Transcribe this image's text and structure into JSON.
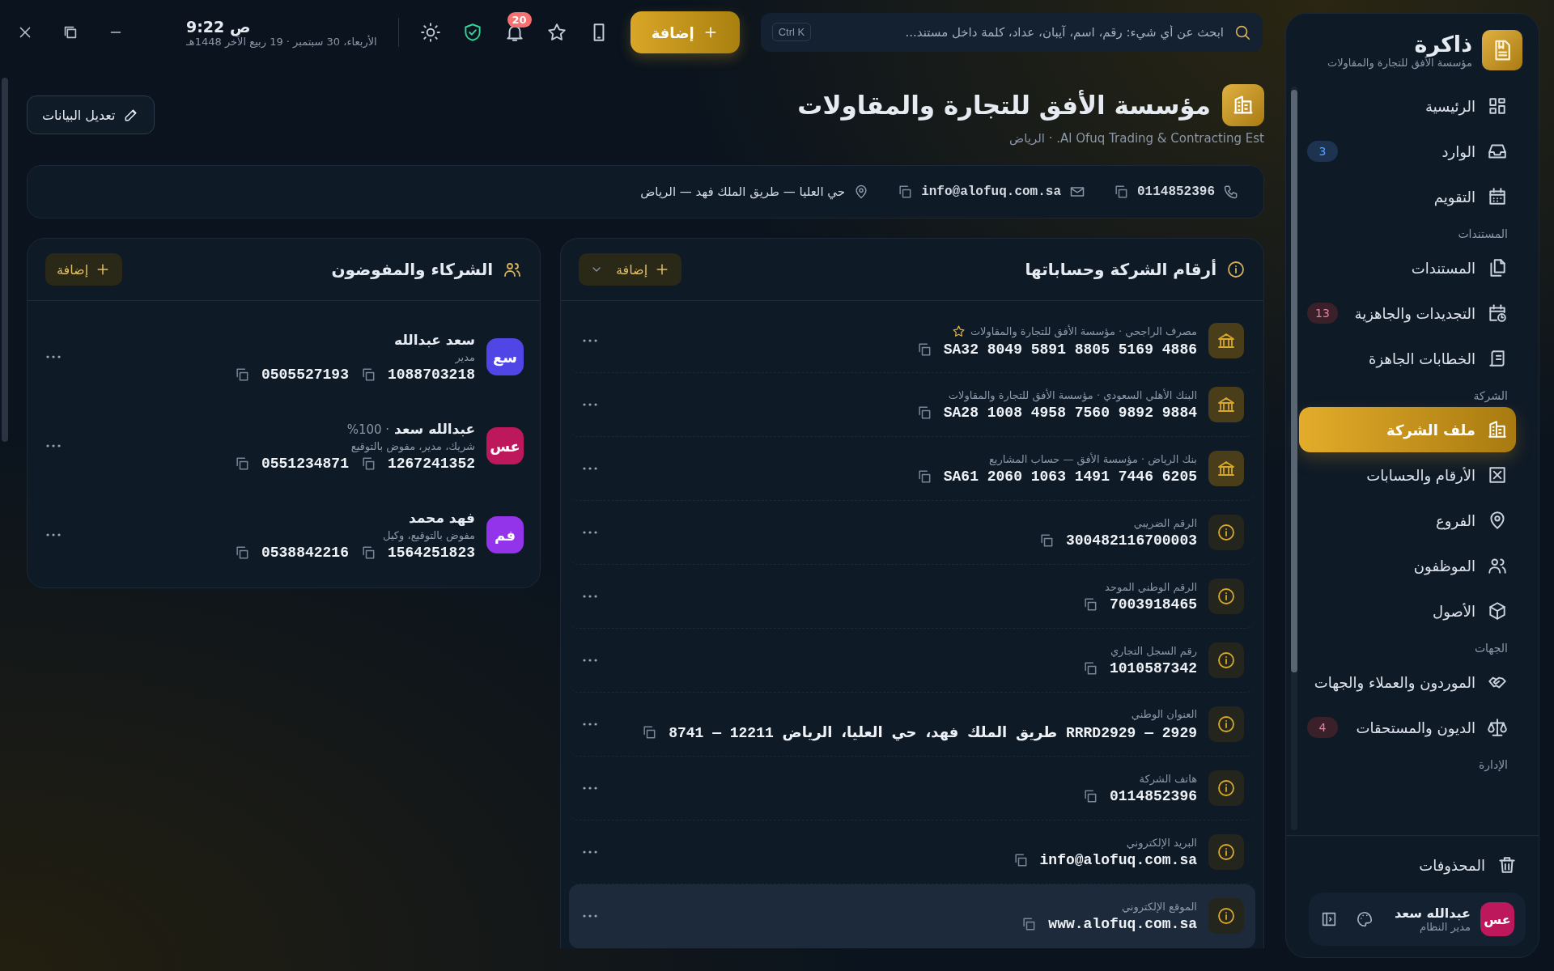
{
  "sidebar": {
    "app_name": "ذاكرة",
    "company": "مؤسسة الأفق للتجارة والمقاولات",
    "items": [
      {
        "kind": "item",
        "label": "الرئيسية",
        "selected": false
      },
      {
        "kind": "item",
        "label": "الوارد",
        "selected": false,
        "badge": {
          "text": "3",
          "color": "#1e3350"
        }
      },
      {
        "kind": "item",
        "label": "التقويم",
        "selected": false
      },
      {
        "kind": "section",
        "label": "المستندات"
      },
      {
        "kind": "item",
        "label": "المستندات",
        "selected": false
      },
      {
        "kind": "item",
        "label": "التجديدات والجاهزية",
        "selected": false,
        "badge": {
          "text": "13",
          "color": "#3a2028"
        }
      },
      {
        "kind": "item",
        "label": "الخطابات الجاهزة",
        "selected": false
      },
      {
        "kind": "section",
        "label": "الشركة"
      },
      {
        "kind": "item",
        "label": "ملف الشركة",
        "selected": true
      },
      {
        "kind": "item",
        "label": "الأرقام والحسابات",
        "selected": false
      },
      {
        "kind": "item",
        "label": "الفروع",
        "selected": false
      },
      {
        "kind": "item",
        "label": "الموظفون",
        "selected": false
      },
      {
        "kind": "item",
        "label": "الأصول",
        "selected": false
      },
      {
        "kind": "section",
        "label": "الجهات"
      },
      {
        "kind": "item",
        "label": "الموردون والعملاء والجهات",
        "selected": false
      },
      {
        "kind": "item",
        "label": "الديون والمستحقات",
        "selected": false,
        "badge": {
          "text": "4",
          "color": "#3a2028"
        }
      },
      {
        "kind": "section",
        "label": "الإدارة"
      }
    ],
    "trash_label": "المحذوفات",
    "user": {
      "initials": "عس",
      "name": "عبدالله سعد",
      "role": "مدير النظام",
      "color": "#be185d"
    }
  },
  "topbar": {
    "search_placeholder": "ابحث عن أي شيء: رقم، اسم، آيبان، عداد، كلمة داخل مستند...",
    "shortcut": "Ctrl K",
    "add_button": "إضافة",
    "notification_count": "20",
    "time": "ص 9:22",
    "date": "الأربعاء، 30 سبتمبر · 19 ربيع الآخر 1448هـ"
  },
  "header": {
    "title": "مؤسسة الأفق للتجارة والمقاولات",
    "subtitle": "Al Ofuq Trading & Contracting Est. · الرياض",
    "edit_button": "تعديل البيانات"
  },
  "contacts": [
    {
      "kind": "phone",
      "value": "0114852396"
    },
    {
      "kind": "email",
      "value": "info@alofuq.com.sa"
    },
    {
      "kind": "location",
      "value": "حي العليا — طريق الملك فهد — الرياض"
    }
  ],
  "accounts": {
    "title": "أرقام الشركة وحساباتها",
    "add_button": "إضافة",
    "rows": [
      {
        "kind": "bank",
        "label": "مصرف الراجحي · مؤسسة الأفق للتجارة والمقاولات",
        "value": "SA32 8049 5891 8805 5169 4886",
        "starred": true,
        "selected": false
      },
      {
        "kind": "bank",
        "label": "البنك الأهلي السعودي · مؤسسة الأفق للتجارة والمقاولات",
        "value": "SA28 1008 4958 7560 9892 9884",
        "starred": false,
        "selected": false
      },
      {
        "kind": "bank",
        "label": "بنك الرياض · مؤسسة الأفق — حساب المشاريع",
        "value": "SA61 2060 1063 1491 7446 6205",
        "starred": false,
        "selected": false
      },
      {
        "kind": "info",
        "label": "الرقم الضريبي",
        "value": "300482116700003",
        "starred": false,
        "selected": false
      },
      {
        "kind": "info",
        "label": "الرقم الوطني الموحد",
        "value": "7003918465",
        "starred": false,
        "selected": false
      },
      {
        "kind": "info",
        "label": "رقم السجل التجاري",
        "value": "1010587342",
        "starred": false,
        "selected": false
      },
      {
        "kind": "info",
        "label": "العنوان الوطني",
        "value": "2929 — RRRD2929 طريق الملك فهد، حي العليا، الرياض 12211 — 8741",
        "starred": false,
        "selected": false
      },
      {
        "kind": "info",
        "label": "هاتف الشركة",
        "value": "0114852396",
        "starred": false,
        "selected": false
      },
      {
        "kind": "info",
        "label": "البريد الإلكتروني",
        "value": "info@alofuq.com.sa",
        "starred": false,
        "selected": false
      },
      {
        "kind": "info",
        "label": "الموقع الإلكتروني",
        "value": "www.alofuq.com.sa",
        "starred": false,
        "selected": true
      }
    ]
  },
  "partners": {
    "title": "الشركاء والمفوضون",
    "add_button": "إضافة",
    "items": [
      {
        "initials": "سع",
        "color": "#4f46e5",
        "name": "سعد عبدالله",
        "roles": "مدير",
        "id_number": "1088703218",
        "phone": "0505527193"
      },
      {
        "initials": "عس",
        "color": "#be185d",
        "name": "عبدالله سعد",
        "share": "· %100",
        "roles": "شريك، مدير، مفوض بالتوقيع",
        "id_number": "1267241352",
        "phone": "0551234871"
      },
      {
        "initials": "فم",
        "color": "#9333ea",
        "name": "فهد محمد",
        "roles": "مفوض بالتوقيع، وكيل",
        "id_number": "1564251823",
        "phone": "0538842216"
      }
    ]
  }
}
